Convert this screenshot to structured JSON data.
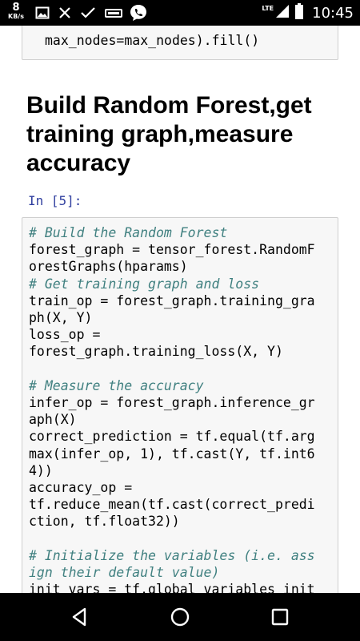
{
  "status_bar": {
    "net_speed": "8",
    "net_unit": "KB/s",
    "network_type": "LTE",
    "time": "10:45",
    "icons": [
      "image-icon",
      "close-x-icon",
      "check-icon",
      "good-badge-icon",
      "chat-phone-icon",
      "signal-icon",
      "battery-icon"
    ]
  },
  "notebook": {
    "previous_cell_tail": "max_nodes=max_nodes).fill()",
    "heading": "Build Random Forest,get training graph,measure accuracy",
    "prompt": "In [5]:",
    "code_lines": [
      {
        "text": "# Build the Random Forest",
        "type": "comment"
      },
      {
        "text": "forest_graph = tensor_forest.RandomF",
        "type": "code"
      },
      {
        "text": "orestGraphs(hparams)",
        "type": "code"
      },
      {
        "text": "# Get training graph and loss",
        "type": "comment"
      },
      {
        "text": "train_op = forest_graph.training_gra",
        "type": "code"
      },
      {
        "text": "ph(X, Y)",
        "type": "code"
      },
      {
        "text": "loss_op =",
        "type": "code"
      },
      {
        "text": "forest_graph.training_loss(X, Y)",
        "type": "code"
      },
      {
        "text": "",
        "type": "blank"
      },
      {
        "text": "# Measure the accuracy",
        "type": "comment"
      },
      {
        "text": "infer_op = forest_graph.inference_gr",
        "type": "code"
      },
      {
        "text": "aph(X)",
        "type": "code"
      },
      {
        "text": "correct_prediction = tf.equal(tf.arg",
        "type": "code"
      },
      {
        "text": "max(infer_op, 1), tf.cast(Y, tf.int6",
        "type": "code"
      },
      {
        "text": "4))",
        "type": "code"
      },
      {
        "text": "accuracy_op =",
        "type": "code"
      },
      {
        "text": "tf.reduce_mean(tf.cast(correct_predi",
        "type": "code"
      },
      {
        "text": "ction, tf.float32))",
        "type": "code"
      },
      {
        "text": "",
        "type": "blank"
      },
      {
        "text": "# Initialize the variables (i.e. ass",
        "type": "comment"
      },
      {
        "text": "ign their default value)",
        "type": "comment"
      },
      {
        "text": "init_vars = tf.global_variables_init",
        "type": "code"
      }
    ]
  },
  "nav_bar": {
    "buttons": [
      "back-icon",
      "home-icon",
      "recents-icon"
    ]
  },
  "colors": {
    "comment": "#408080",
    "prompt": "#303f9f",
    "cell_background": "#f7f7f7",
    "cell_border": "#cfcfcf"
  }
}
